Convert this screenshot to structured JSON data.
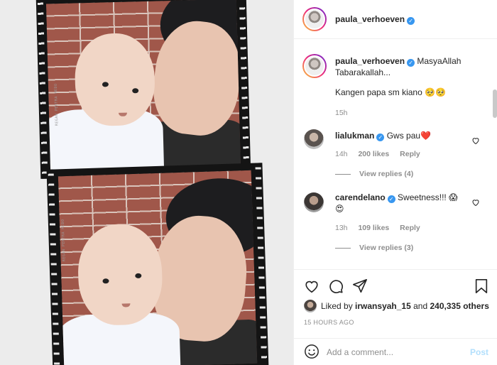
{
  "post": {
    "author": "paula_verhoeven",
    "caption_author": "paula_verhoeven",
    "caption_text": "MasyaAllah Tabarakallah...",
    "caption_line2": "Kangen papa sm kiano 🥺🥺",
    "caption_time": "15h"
  },
  "media": {
    "strip_label": "REGAN PERTRA MEDO"
  },
  "comments": [
    {
      "username": "lialukman",
      "text": "Gws pau❤️",
      "time": "14h",
      "likes": "200 likes",
      "reply": "Reply",
      "view_replies": "View replies (4)"
    },
    {
      "username": "carendelano",
      "text": "Sweetness!!! 😱",
      "text2": "😍",
      "time": "13h",
      "likes": "109 likes",
      "reply": "Reply",
      "view_replies": "View replies (3)"
    }
  ],
  "likes": {
    "prefix": "Liked by",
    "user": "irwansyah_15",
    "middle": "and",
    "count": "240,335 others"
  },
  "timestamp": "15 HOURS AGO",
  "add_comment": {
    "placeholder": "Add a comment...",
    "post_label": "Post"
  },
  "colors": {
    "verified": "#3897f0",
    "post_disabled": "#b2dffc"
  },
  "icons": [
    "verified-icon",
    "heart-icon",
    "comment-icon",
    "share-icon",
    "bookmark-icon",
    "emoji-icon"
  ]
}
